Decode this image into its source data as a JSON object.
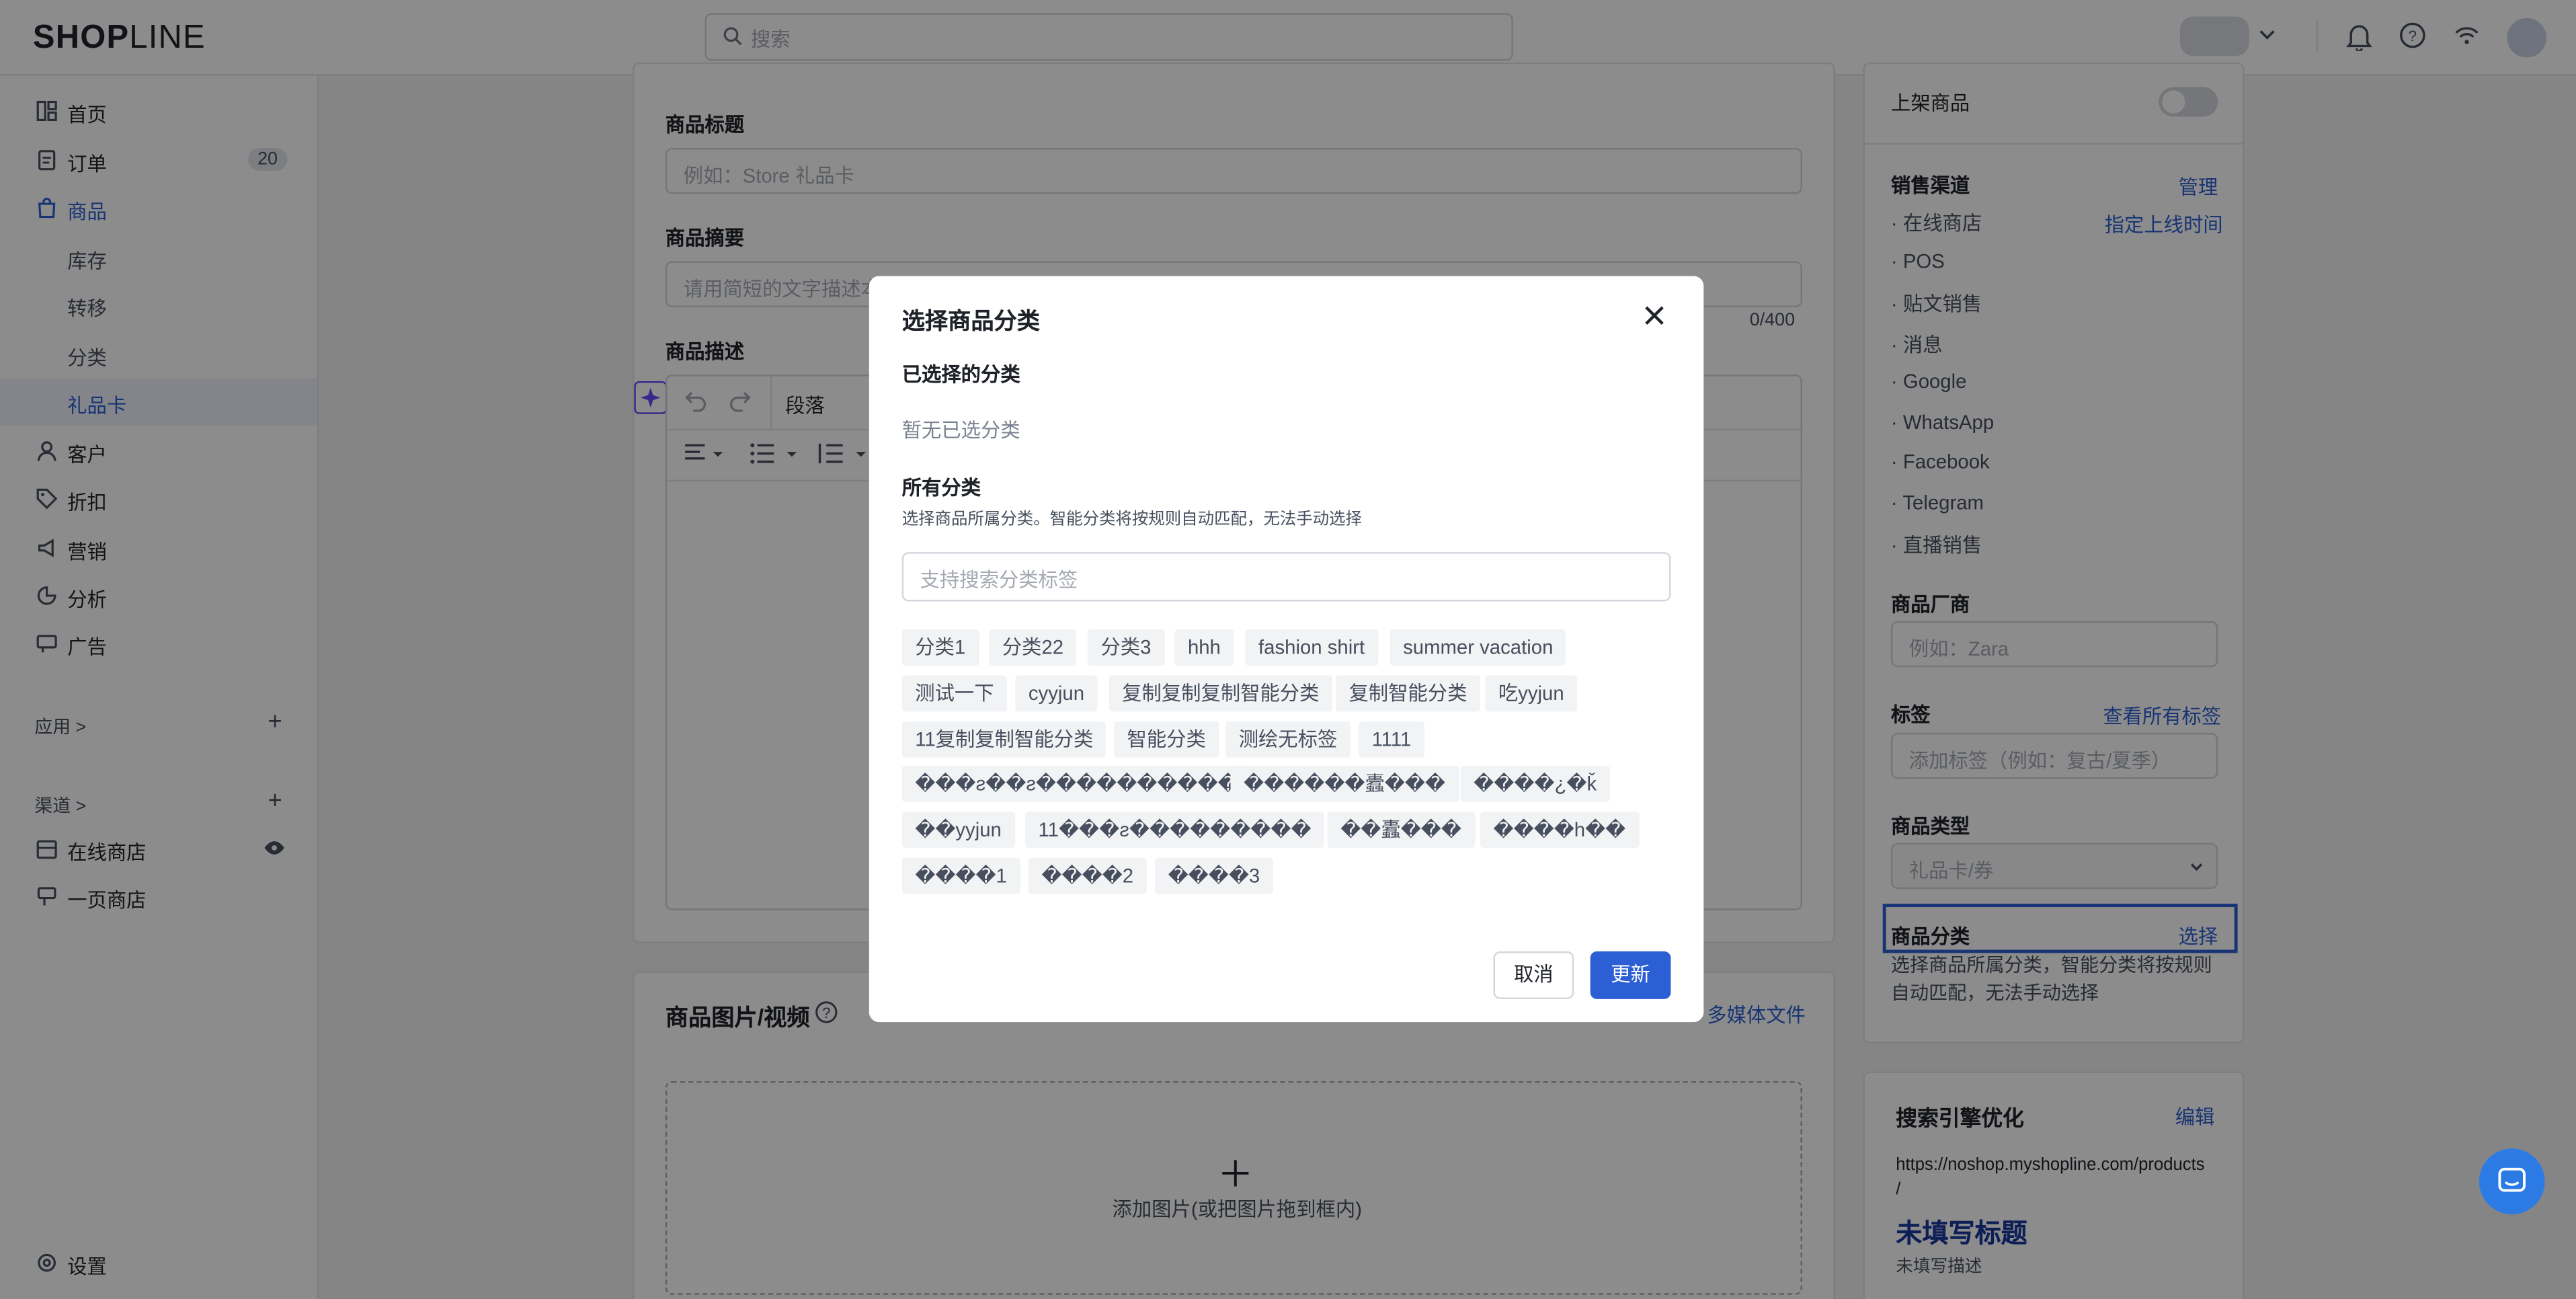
{
  "header": {
    "logo_main": "SHOP",
    "logo_tail": "LINE",
    "search_placeholder": "搜索",
    "accent": "#2c5fd3"
  },
  "sidebar": {
    "items": [
      {
        "label": "首页",
        "icon": "dashboard-icon"
      },
      {
        "label": "订单",
        "icon": "order-icon",
        "badge": "20"
      },
      {
        "label": "商品",
        "icon": "bag-icon"
      },
      {
        "label": "库存"
      },
      {
        "label": "转移"
      },
      {
        "label": "分类"
      },
      {
        "label": "礼品卡"
      },
      {
        "label": "客户",
        "icon": "user-icon"
      },
      {
        "label": "折扣",
        "icon": "tag-icon"
      },
      {
        "label": "营销",
        "icon": "marketing-icon"
      },
      {
        "label": "分析",
        "icon": "chart-icon"
      },
      {
        "label": "广告",
        "icon": "ad-icon"
      }
    ],
    "apps_label": "应用 >",
    "channels_label": "渠道 >",
    "channels": [
      {
        "label": "在线商店"
      },
      {
        "label": "一页商店"
      }
    ],
    "settings_label": "设置"
  },
  "main": {
    "title_label": "商品标题",
    "title_placeholder": "例如：Store 礼品卡",
    "summary_label": "商品摘要",
    "summary_placeholder": "请用简短的文字描述本商品",
    "summary_count": "0/400",
    "desc_label": "商品描述",
    "paragraph_label": "段落",
    "media_label": "商品图片/视频",
    "media_link": "多媒体文件",
    "add_media": "添加图片(或把图片拖到框内)"
  },
  "right": {
    "publish_label": "上架商品",
    "channels_label": "销售渠道",
    "manage_link": "管理",
    "schedule_link": "指定上线时间",
    "channels": [
      "在线商店",
      "POS",
      "贴文销售",
      "消息",
      "Google",
      "WhatsApp",
      "Facebook",
      "Telegram",
      "直播销售"
    ],
    "vendor_label": "商品厂商",
    "vendor_placeholder": "例如：Zara",
    "tags_label": "标签",
    "tags_link": "查看所有标签",
    "tags_placeholder": "添加标签（例如：复古/夏季）",
    "type_label": "商品类型",
    "type_value": "礼品卡/券",
    "category_label": "商品分类",
    "category_link": "选择",
    "category_help_1": "选择商品所属分类，智能分类将按规则",
    "category_help_2": "自动匹配，无法手动选择",
    "seo_label": "搜索引擎优化",
    "seo_link": "编辑",
    "seo_url": "https://noshop.myshopline.com/products",
    "seo_url_tail": "/",
    "seo_title": "未填写标题",
    "seo_desc": "未填写描述"
  },
  "modal": {
    "title": "选择商品分类",
    "selected_label": "已选择的分类",
    "selected_empty": "暂无已选分类",
    "all_label": "所有分类",
    "all_help": "选择商品所属分类。智能分类将按规则自动匹配，无法手动选择",
    "search_placeholder": "支持搜索分类标签",
    "chips": [
      [
        "分类1",
        "分类22",
        "分类3",
        "hhh",
        "fashion shirt",
        "summer vacation"
      ],
      [
        "测试一下",
        "cyyjun",
        "复制复制复制智能分类",
        "复制智能分类",
        "吃yyjun"
      ],
      [
        "11复制复制智能分类",
        "智能分类",
        "测绘无标签",
        "1111"
      ],
      [
        "���ƨ��ƨ����������",
        "������蠹���",
        "����¿�ǩ"
      ],
      [
        "��yyjun",
        "11���ƨ���������",
        "��蠹���",
        "����h��"
      ],
      [
        "����1",
        "����2",
        "����3"
      ]
    ],
    "cancel": "取消",
    "update": "更新"
  }
}
